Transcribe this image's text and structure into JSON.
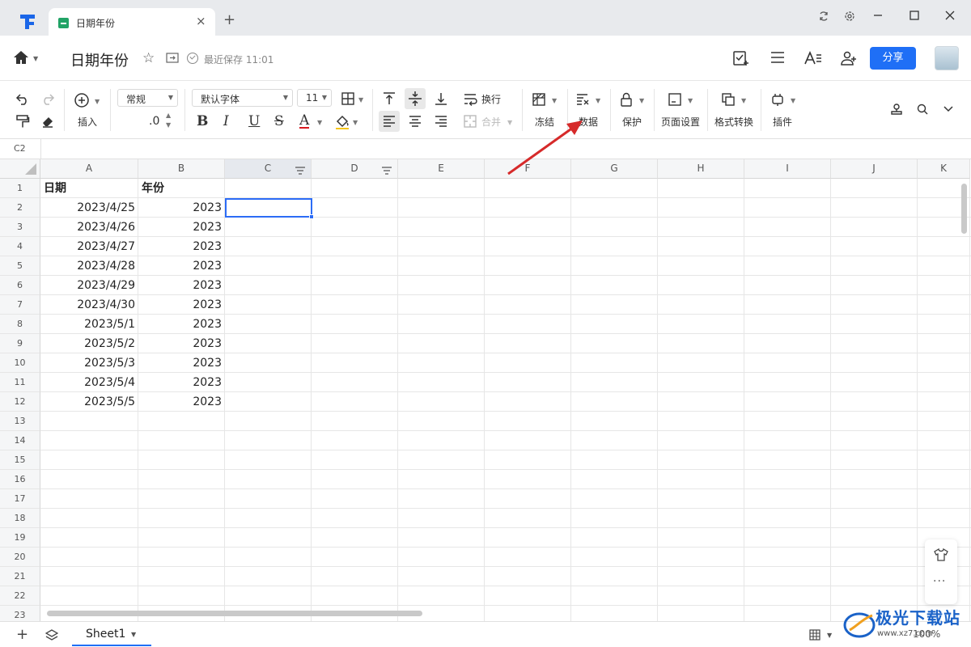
{
  "window": {
    "tab_title": "日期年份",
    "new_tab": "+",
    "close_tab": "×",
    "controls": [
      "refresh-icon",
      "settings-icon",
      "minimize-icon",
      "maximize-icon",
      "close-icon"
    ]
  },
  "doc_header": {
    "title": "日期年份",
    "save_status": "最近保存 11:01",
    "share_label": "分享"
  },
  "toolbar": {
    "insert_label": "插入",
    "number_format": "常规",
    "decimal_label": ".0",
    "font_name": "默认字体",
    "font_size": "11",
    "bold": "B",
    "italic": "I",
    "underline": "U",
    "strike": "S",
    "font_color": "A",
    "wrap_label": "换行",
    "merge_label": "合并",
    "freeze_label": "冻结",
    "data_label": "数据",
    "protect_label": "保护",
    "page_setup_label": "页面设置",
    "format_convert_label": "格式转换",
    "plugin_label": "插件"
  },
  "name_box": "C2",
  "grid": {
    "columns": [
      "A",
      "B",
      "C",
      "D",
      "E",
      "F",
      "G",
      "H",
      "I",
      "J",
      "K"
    ],
    "rows": [
      "1",
      "2",
      "3",
      "4",
      "5",
      "6",
      "7",
      "8",
      "9",
      "10",
      "11",
      "12",
      "13",
      "14",
      "15",
      "16",
      "17",
      "18",
      "19",
      "20",
      "21",
      "22",
      "23"
    ],
    "header_row": [
      "日期",
      "年份"
    ],
    "data": [
      [
        "2023/4/25",
        "2023"
      ],
      [
        "2023/4/26",
        "2023"
      ],
      [
        "2023/4/27",
        "2023"
      ],
      [
        "2023/4/28",
        "2023"
      ],
      [
        "2023/4/29",
        "2023"
      ],
      [
        "2023/4/30",
        "2023"
      ],
      [
        "2023/5/1",
        "2023"
      ],
      [
        "2023/5/2",
        "2023"
      ],
      [
        "2023/5/3",
        "2023"
      ],
      [
        "2023/5/4",
        "2023"
      ],
      [
        "2023/5/5",
        "2023"
      ]
    ],
    "selected_cell": "C2"
  },
  "sheet_bar": {
    "sheet_name": "Sheet1",
    "zoom": "100%"
  },
  "watermark": {
    "text": "极光下载站",
    "sub": "www.xz7.com"
  },
  "colors": {
    "accent": "#1f6ff6",
    "selection": "#2c6cf6",
    "annotation_arrow": "#d62a2a",
    "sheet_icon": "#21a366"
  }
}
